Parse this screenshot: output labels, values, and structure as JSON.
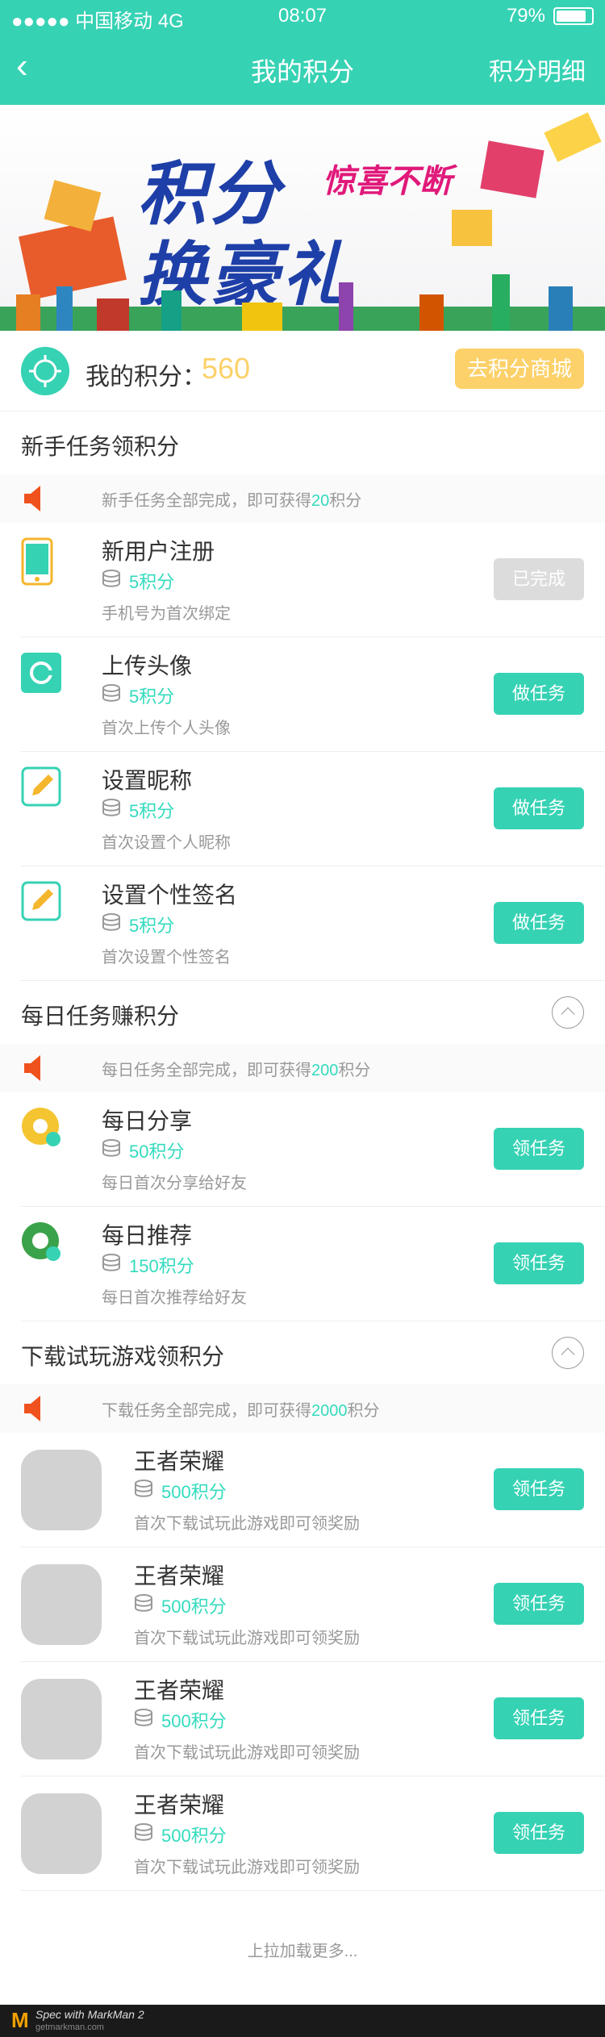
{
  "status_bar": {
    "carrier": "●●●●● 中国移动  4G",
    "time": "08:07",
    "battery_text": "79%"
  },
  "nav": {
    "back_icon": "chevron-left-icon",
    "title": "我的积分",
    "detail_label": "积分明细"
  },
  "banner": {
    "line1": "积分",
    "line2": "换豪礼",
    "tagline": "惊喜不断"
  },
  "points": {
    "label": "我的积分：",
    "value": "560",
    "mall_button": "去积分商城"
  },
  "newbie": {
    "title": "新手任务领积分",
    "notice_prefix": "新手任务全部完成，即可获得",
    "notice_value": "20",
    "notice_suffix": "积分",
    "tasks": [
      {
        "name": "新用户注册",
        "points": "5积分",
        "desc": "手机号为首次绑定",
        "button": "已完成",
        "done": true,
        "icon": "phone-icon"
      },
      {
        "name": "上传头像",
        "points": "5积分",
        "desc": "首次上传个人头像",
        "button": "做任务",
        "done": false,
        "icon": "camera-icon"
      },
      {
        "name": "设置昵称",
        "points": "5积分",
        "desc": "首次设置个人昵称",
        "button": "做任务",
        "done": false,
        "icon": "pencil-icon"
      },
      {
        "name": "设置个性签名",
        "points": "5积分",
        "desc": "首次设置个性签名",
        "button": "做任务",
        "done": false,
        "icon": "pencil-icon"
      }
    ]
  },
  "daily": {
    "title": "每日任务赚积分",
    "notice_prefix": "每日任务全部完成，即可获得",
    "notice_value": "200",
    "notice_suffix": "积分",
    "tasks": [
      {
        "name": "每日分享",
        "points": "50积分",
        "desc": "每日首次分享给好友",
        "button": "领任务",
        "icon": "share-icon"
      },
      {
        "name": "每日推荐",
        "points": "150积分",
        "desc": "每日首次推荐给好友",
        "button": "领任务",
        "icon": "recommend-icon"
      }
    ]
  },
  "games": {
    "title": "下载试玩游戏领积分",
    "notice_prefix": "下载任务全部完成，即可获得",
    "notice_value": "2000",
    "notice_suffix": "积分",
    "items": [
      {
        "name": "王者荣耀",
        "points": "500积分",
        "desc": "首次下载试玩此游戏即可领奖励",
        "button": "领任务"
      },
      {
        "name": "王者荣耀",
        "points": "500积分",
        "desc": "首次下载试玩此游戏即可领奖励",
        "button": "领任务"
      },
      {
        "name": "王者荣耀",
        "points": "500积分",
        "desc": "首次下载试玩此游戏即可领奖励",
        "button": "领任务"
      },
      {
        "name": "王者荣耀",
        "points": "500积分",
        "desc": "首次下载试玩此游戏即可领奖励",
        "button": "领任务"
      }
    ]
  },
  "load_more": "上拉加载更多...",
  "footer": {
    "logo": "M",
    "title": "Spec with MarkMan 2",
    "site": "getmarkman.com"
  },
  "colors": {
    "primary": "#36d2b4",
    "accent": "#34dbbe",
    "gold": "#fdd169",
    "notice_bg": "#fafafa"
  }
}
